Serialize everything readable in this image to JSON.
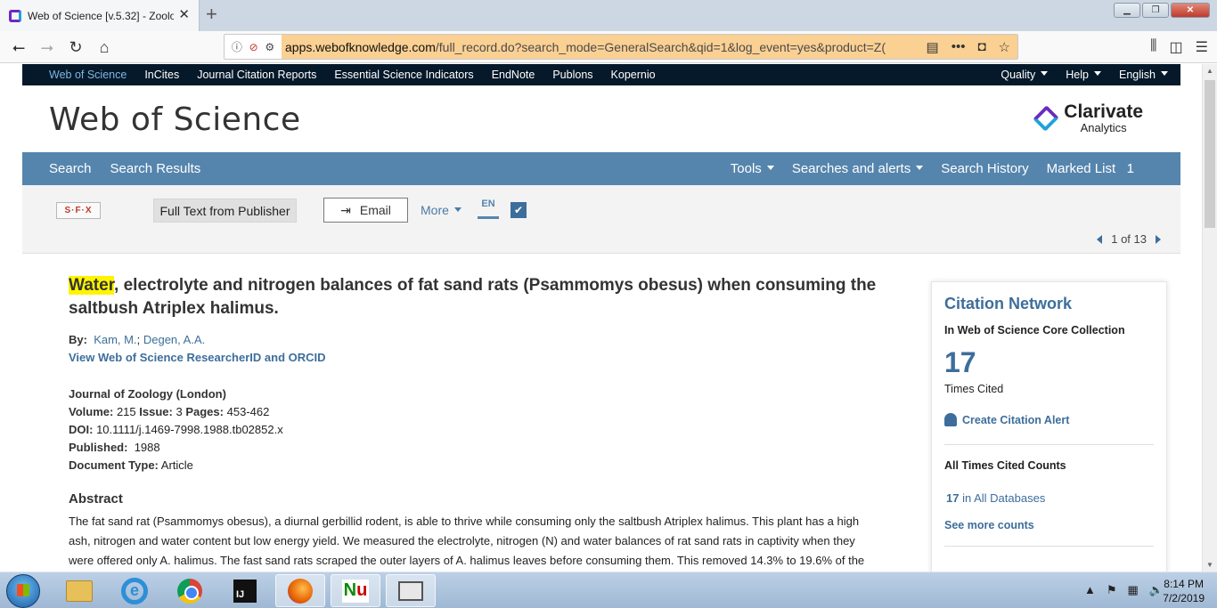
{
  "browser": {
    "tab_title": "Web of Science [v.5.32] - Zoolo",
    "tab_close": "✕",
    "new_tab": "+",
    "url_domain": "apps.webofknowledge.com",
    "url_path": "/full_record.do?search_mode=GeneralSearch&qid=1&log_event=yes&product=Z("
  },
  "wos_topnav": {
    "items": [
      "Web of Science",
      "InCites",
      "Journal Citation Reports",
      "Essential Science Indicators",
      "EndNote",
      "Publons",
      "Kopernio"
    ],
    "right": [
      "Quality",
      "Help",
      "English"
    ]
  },
  "brand": {
    "title": "Web of Science",
    "clarivate_name": "Clarivate",
    "clarivate_sub": "Analytics"
  },
  "searchbar": {
    "left": [
      "Search",
      "Search Results"
    ],
    "tools": "Tools",
    "alerts": "Searches and alerts",
    "history": "Search History",
    "marked": "Marked List",
    "marked_count": "1"
  },
  "toolbar": {
    "sfx": "S·F·X",
    "fulltext": "Full Text from Publisher",
    "email": "Email",
    "more": "More",
    "en": "EN",
    "pager_text": "1 of 13"
  },
  "record": {
    "title_highlight": "Water",
    "title_rest": ", electrolyte and nitrogen balances of fat sand rats (Psammomys obesus) when consuming the saltbush Atriplex halimus.",
    "by_label": "By:",
    "author1": "Kam, M.",
    "author_sep": ";",
    "author2": "Degen, A.A.",
    "researcherid_link": "View Web of Science ResearcherID and ORCID",
    "journal": "Journal of Zoology (London)",
    "volume_label": "Volume:",
    "volume": "215",
    "issue_label": "Issue:",
    "issue": "3",
    "pages_label": "Pages:",
    "pages": "453-462",
    "doi_label": "DOI:",
    "doi": "10.1111/j.1469-7998.1988.tb02852.x",
    "published_label": "Published:",
    "published": "1988",
    "doctype_label": "Document Type:",
    "doctype": "Article",
    "abstract_heading": "Abstract",
    "abstract": "The fat sand rat (Psammomys obesus), a diurnal gerbillid rodent, is able to thrive while consuming only the saltbush Atriplex halimus. This plant has a high ash, nitrogen and water content but low energy yield. We measured the electrolyte, nitrogen (N) and water balances of rat sand rats in captivity when they were offered only A. halimus. The fast sand rats scraped the outer layers of A. halimus leaves before consuming them. This removed 14.3% to 19.6% of the"
  },
  "citation": {
    "title": "Citation Network",
    "collection": "In Web of Science Core Collection",
    "times_cited": "17",
    "times_cited_label": "Times Cited",
    "alert": "Create Citation Alert",
    "all_counts": "All Times Cited Counts",
    "db_count": "17",
    "db_label": "in All Databases",
    "see_more": "See more counts"
  },
  "taskbar": {
    "time": "8:14 PM",
    "date": "7/2/2019"
  }
}
